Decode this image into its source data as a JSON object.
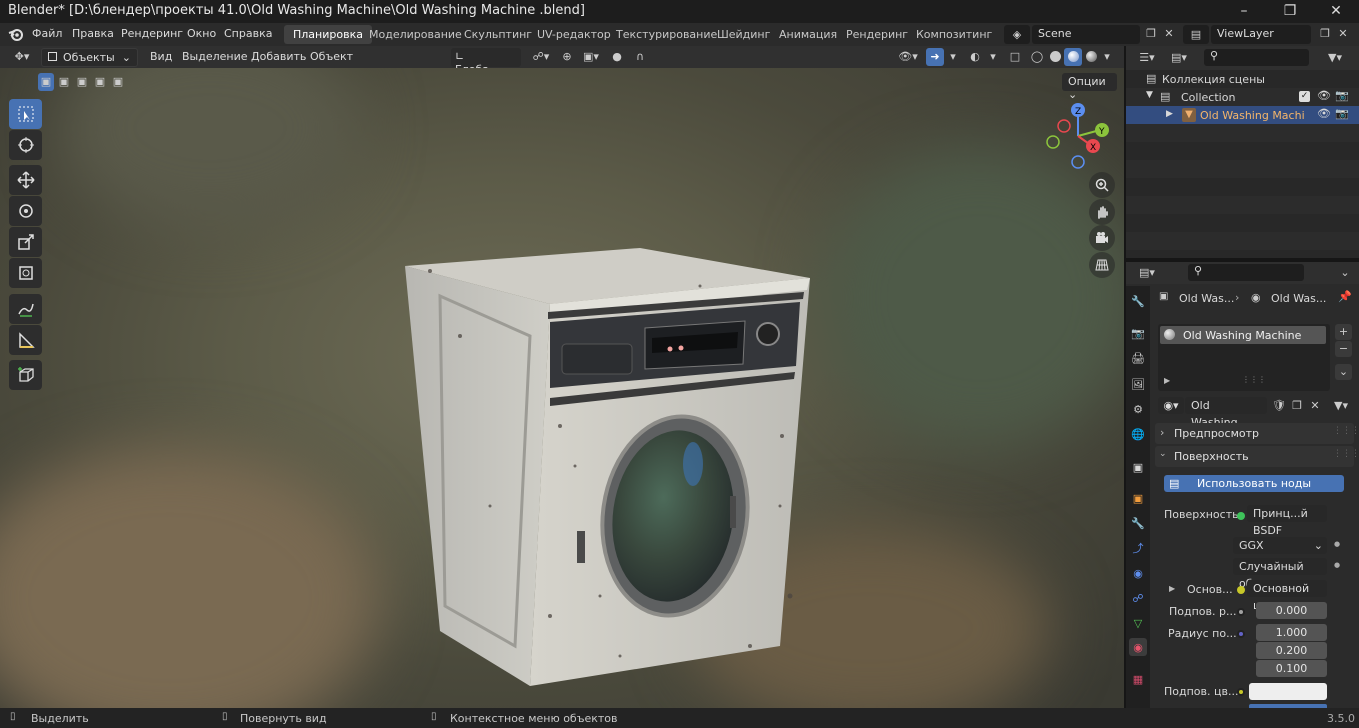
{
  "title": "Blender* [D:\\блендер\\проекты 41.0\\Old Washing Machine\\Old Washing Machine .blend]",
  "menu": [
    "Файл",
    "Правка",
    "Рендеринг",
    "Окно",
    "Справка"
  ],
  "workspaces": [
    "Планировка",
    "Моделирование",
    "Скульптинг",
    "UV-редактор",
    "Текстурирование",
    "Шейдинг",
    "Анимация",
    "Рендеринг",
    "Композитинг"
  ],
  "active_workspace": "Планировка",
  "scene": "Scene",
  "view_layer": "ViewLayer",
  "viewport_header": {
    "mode": "Объекты",
    "menus": [
      "Вид",
      "Выделение",
      "Добавить",
      "Объект"
    ],
    "orientation": "Глоба...",
    "options": "Опции"
  },
  "gizmo": {
    "x": "X",
    "y": "Y",
    "z": "Z"
  },
  "outliner": {
    "root": "Коллекция сцены",
    "collection": "Collection",
    "object": "Old Washing Machine"
  },
  "properties": {
    "breadcrumb_object": "Old Was...",
    "breadcrumb_material": "Old Was...",
    "slot": "Old Washing Machine",
    "material_name": "Old Washing...",
    "panel_preview": "Предпросмотр",
    "panel_surface": "Поверхность",
    "use_nodes": "Использовать ноды",
    "surface_label": "Поверхность",
    "surface_value": "Принц...й BSDF",
    "distribution": "GGX",
    "subsurface_method": "Случайный об...",
    "base_label": "Основ...",
    "base_value": "Основной цвет",
    "ss_label": "Подпов. р...",
    "ss_value": "0.000",
    "radius_label": "Радиус по...",
    "radius_values": [
      "1.000",
      "0.200",
      "0.100"
    ],
    "ss_color_label": "Подпов. цв..."
  },
  "status": {
    "select": "Выделить",
    "rotate": "Повернуть вид",
    "context": "Контекстное меню объектов",
    "version": "3.5.0"
  }
}
